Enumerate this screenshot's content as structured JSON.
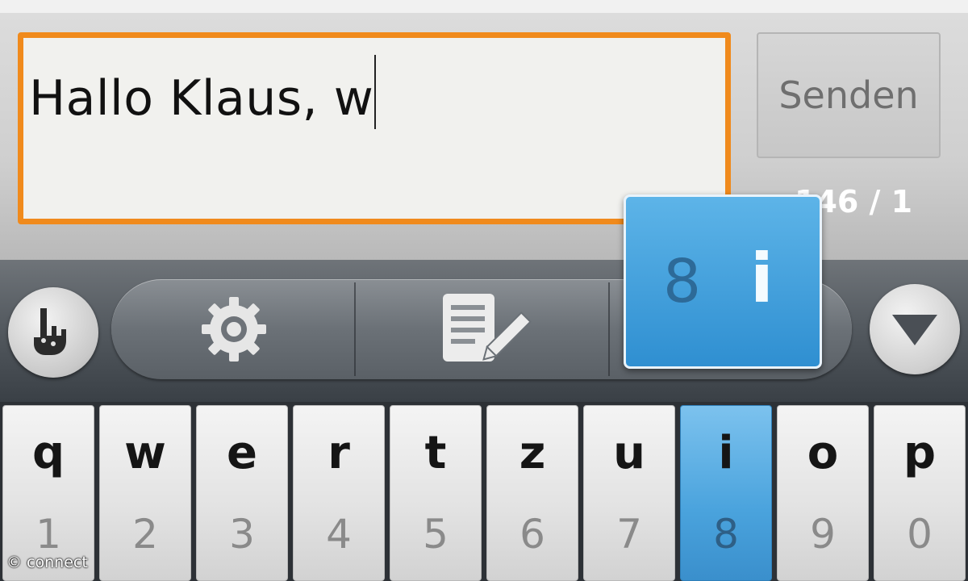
{
  "compose": {
    "message_value": "Hallo Klaus, w",
    "send_label": "Senden",
    "char_counter": "146 / 1"
  },
  "toolbar": {
    "logo_icon": "swype-hand-icon",
    "settings_icon": "gear-icon",
    "edit_icon": "edit-word-icon",
    "collapse_icon": "triangle-down-icon"
  },
  "key_popup": {
    "alt_char": "8",
    "main_char": "i"
  },
  "keyboard": {
    "keys": [
      {
        "letter": "q",
        "number": "1"
      },
      {
        "letter": "w",
        "number": "2"
      },
      {
        "letter": "e",
        "number": "3"
      },
      {
        "letter": "r",
        "number": "4"
      },
      {
        "letter": "t",
        "number": "5"
      },
      {
        "letter": "z",
        "number": "6"
      },
      {
        "letter": "u",
        "number": "7"
      },
      {
        "letter": "i",
        "number": "8"
      },
      {
        "letter": "o",
        "number": "9"
      },
      {
        "letter": "p",
        "number": "0"
      }
    ],
    "active_key": "i"
  },
  "watermark": "© connect",
  "colors": {
    "focus_border": "#f08a1c",
    "key_highlight": "#4aa3dd",
    "popup_bg": "#2f8fd1"
  }
}
